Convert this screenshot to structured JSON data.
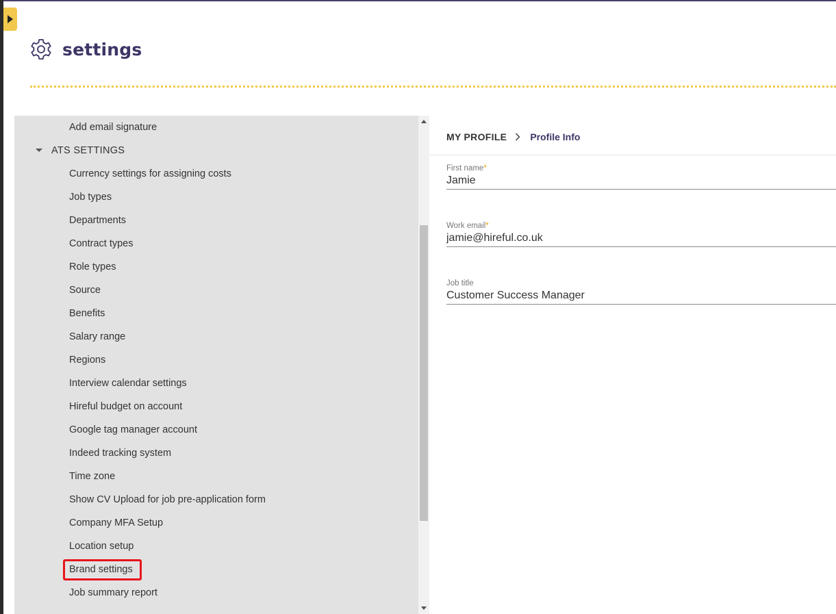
{
  "header": {
    "title": "settings",
    "icon": "gear-icon"
  },
  "sidebar": {
    "top_item": "Add email signature",
    "group_label": "ATS SETTINGS",
    "items": [
      "Currency settings for assigning costs",
      "Job types",
      "Departments",
      "Contract types",
      "Role types",
      "Source",
      "Benefits",
      "Salary range",
      "Regions",
      "Interview calendar settings",
      "Hireful budget on account",
      "Google tag manager account",
      "Indeed tracking system",
      "Time zone",
      "Show CV Upload for job pre-application form",
      "Company MFA Setup",
      "Location setup",
      "Brand settings",
      "Job summary report"
    ],
    "highlighted_item": "Brand settings"
  },
  "breadcrumb": {
    "root": "MY PROFILE",
    "current": "Profile Info"
  },
  "form": {
    "first_name": {
      "label": "First name",
      "required_mark": "*",
      "value": "Jamie"
    },
    "work_email": {
      "label": "Work email",
      "required_mark": "*",
      "value": "jamie@hireful.co.uk"
    },
    "job_title": {
      "label": "Job title",
      "value": "Customer Success Manager"
    }
  },
  "colors": {
    "brand_purple": "#3d3566",
    "accent_yellow": "#f2c94c",
    "highlight_red": "#e8141c",
    "sidebar_bg": "#e2e2e2"
  }
}
